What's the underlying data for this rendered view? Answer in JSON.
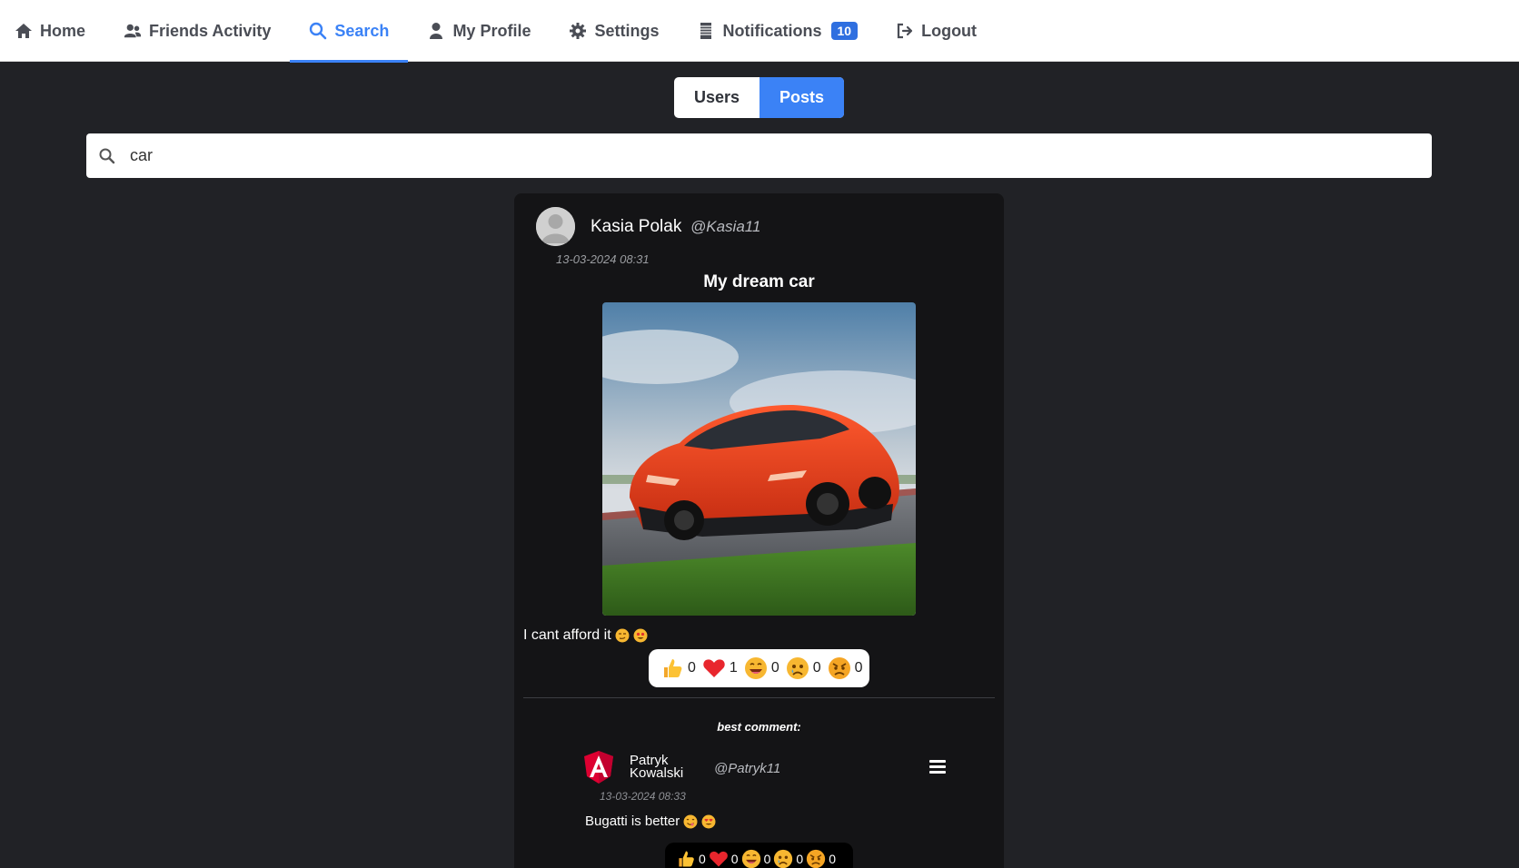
{
  "nav": {
    "items": [
      {
        "label": "Home",
        "icon": "home-icon"
      },
      {
        "label": "Friends Activity",
        "icon": "users-icon"
      },
      {
        "label": "Search",
        "icon": "search-icon",
        "active": true
      },
      {
        "label": "My Profile",
        "icon": "user-icon"
      },
      {
        "label": "Settings",
        "icon": "gear-icon"
      },
      {
        "label": "Notifications",
        "icon": "list-icon",
        "badge": "10"
      },
      {
        "label": "Logout",
        "icon": "logout-icon"
      }
    ]
  },
  "search_tabs": {
    "users": "Users",
    "posts": "Posts",
    "active": "Posts"
  },
  "search": {
    "value": "car",
    "icon": "search-icon"
  },
  "post": {
    "author_name": "Kasia Polak",
    "author_handle": "@Kasia11",
    "date": "13-03-2024 08:31",
    "title": "My dream car",
    "text": "I cant afford it",
    "text_emojis": [
      "smirking-emoji",
      "star-struck-emoji"
    ],
    "reactions": [
      {
        "icon": "thumbs-up-icon",
        "count": "0"
      },
      {
        "icon": "heart-icon",
        "count": "1"
      },
      {
        "icon": "laughing-icon",
        "count": "0"
      },
      {
        "icon": "sad-icon",
        "count": "0"
      },
      {
        "icon": "angry-icon",
        "count": "0"
      }
    ]
  },
  "best_comment": {
    "label": "best comment:",
    "author_name": "Patryk Kowalski",
    "author_handle": "@Patryk11",
    "date": "13-03-2024 08:33",
    "text": "Bugatti is better",
    "reactions": [
      {
        "icon": "thumbs-up-icon",
        "count": "0"
      },
      {
        "icon": "heart-icon",
        "count": "0"
      },
      {
        "icon": "laughing-icon",
        "count": "0"
      },
      {
        "icon": "sad-icon",
        "count": "0"
      },
      {
        "icon": "angry-icon",
        "count": "0"
      }
    ]
  },
  "colors": {
    "accent": "#3b82f6",
    "background": "#212226",
    "card": "#141416"
  }
}
